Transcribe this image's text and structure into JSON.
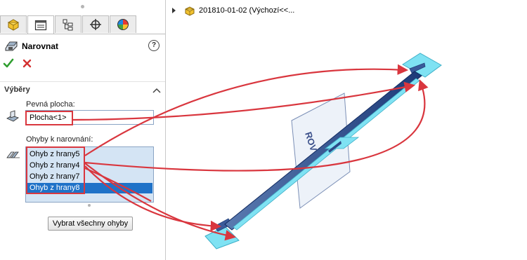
{
  "panel": {
    "title": "Narovnat",
    "help_glyph": "?",
    "tabs": [
      "feature-manager",
      "property-manager",
      "configuration-manager",
      "dimxpert-manager",
      "display-manager"
    ],
    "group": {
      "label": "Výběry"
    },
    "fixed_face": {
      "label": "Pevná plocha:",
      "value": "Plocha<1>"
    },
    "bends": {
      "label": "Ohyby k narovnání:",
      "items": [
        "Ohyb z hrany5",
        "Ohyb z hrany4",
        "Ohyb z hrany7",
        "Ohyb z hrany8"
      ],
      "selected_index": 3
    },
    "select_all_label": "Vybrat všechny ohyby"
  },
  "tree": {
    "node_label": "201810-01-02  (Výchozí<<..."
  },
  "colors": {
    "accent": "#d9363e",
    "selection": "#1f72c8",
    "list_bg": "#d4e4f4",
    "part_blue": "#7fe2f3",
    "ok_green": "#2f9e2f"
  }
}
